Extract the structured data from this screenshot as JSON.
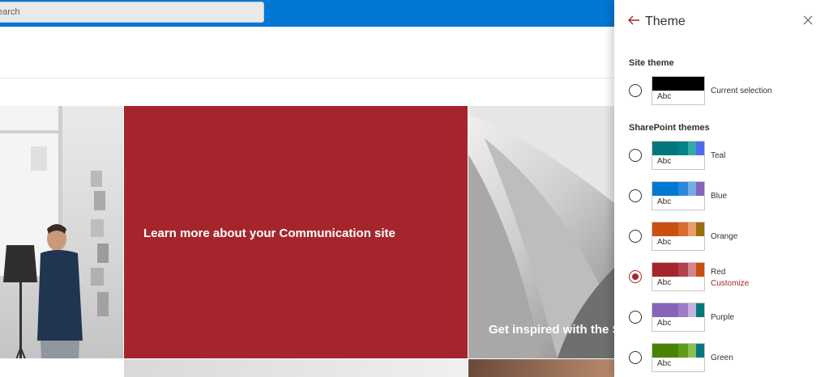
{
  "search": {
    "placeholder": "earch"
  },
  "tiles": {
    "red_title": "Learn more about your Communication site",
    "arch_title": "Get inspired with the S"
  },
  "panel": {
    "title": "Theme",
    "site_theme_label": "Site theme",
    "sharepoint_themes_label": "SharePoint themes",
    "current": {
      "label": "Current selection",
      "sample": "Abc",
      "colors": [
        "#000000"
      ]
    },
    "themes": [
      {
        "name": "Teal",
        "sample": "Abc",
        "colors": [
          "#03787c",
          "#038387",
          "#34a9a4",
          "#4f6bed"
        ]
      },
      {
        "name": "Blue",
        "sample": "Abc",
        "colors": [
          "#0078d4",
          "#2b88d8",
          "#71afe5",
          "#8764b8"
        ]
      },
      {
        "name": "Orange",
        "sample": "Abc",
        "colors": [
          "#ca5010",
          "#d86c2e",
          "#ed9a6e",
          "#986f0b"
        ]
      },
      {
        "name": "Red",
        "sample": "Abc",
        "colors": [
          "#a4262c",
          "#b1414c",
          "#d6848c",
          "#ca5010"
        ],
        "selected": true,
        "action": "Customize"
      },
      {
        "name": "Purple",
        "sample": "Abc",
        "colors": [
          "#8764b8",
          "#9a7dc6",
          "#c3b1e0",
          "#03787c"
        ]
      },
      {
        "name": "Green",
        "sample": "Abc",
        "colors": [
          "#498205",
          "#5d9c14",
          "#8cbd54",
          "#03787c"
        ]
      }
    ]
  }
}
